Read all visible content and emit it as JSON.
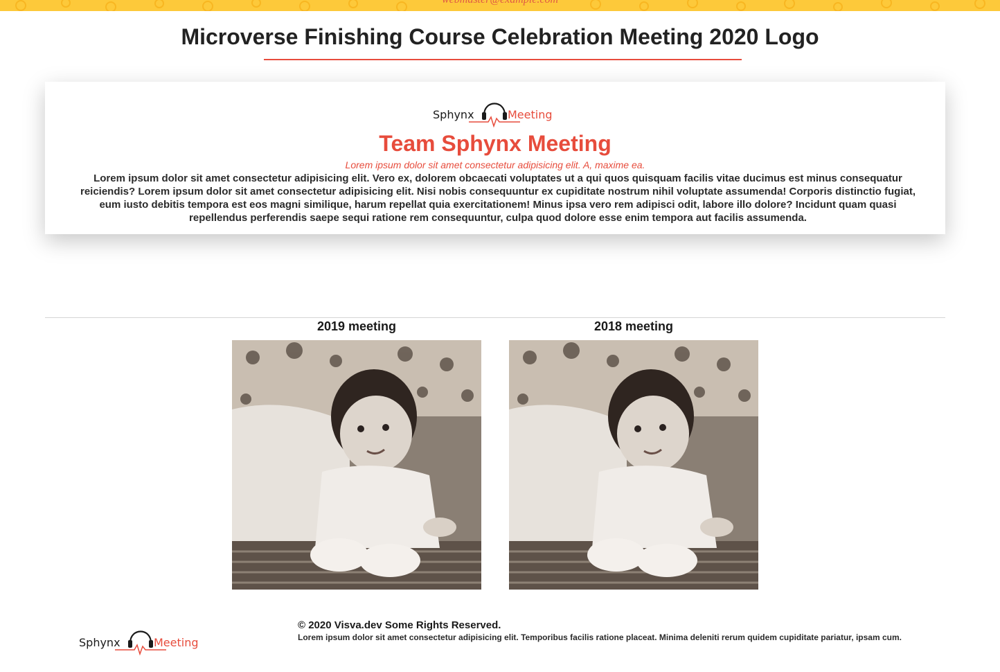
{
  "header": {
    "email": "webmaster@example.com",
    "page_title": "Microverse Finishing Course Celebration Meeting 2020 Logo"
  },
  "about": {
    "logo_left": "Sphynx",
    "logo_right": "Meeting",
    "title": "Team Sphynx Meeting",
    "subtitle": "Lorem ipsum dolor sit amet consectetur adipisicing elit. A, maxime ea.",
    "body": "Lorem ipsum dolor sit amet consectetur adipisicing elit. Vero ex, dolorem obcaecati voluptates ut a qui quos quisquam facilis vitae ducimus est minus consequatur reiciendis? Lorem ipsum dolor sit amet consectetur adipisicing elit. Nisi nobis consequuntur ex cupiditate nostrum nihil voluptate assumenda! Corporis distinctio fugiat, eum iusto debitis tempora est eos magni similique, harum repellat quia exercitationem! Minus ipsa vero rem adipisci odit, labore illo dolore? Incidunt quam quasi repellendus perferendis saepe sequi ratione rem consequuntur, culpa quod dolore esse enim tempora aut facilis assumenda."
  },
  "gallery": {
    "items": [
      {
        "caption": "2019 meeting"
      },
      {
        "caption": "2018 meeting"
      }
    ]
  },
  "footer": {
    "logo_left": "Sphynx",
    "logo_right": "Meeting",
    "copyright": "© 2020 Visva.dev Some Rights Reserved.",
    "text": "Lorem ipsum dolor sit amet consectetur adipisicing elit. Temporibus facilis ratione placeat. Minima deleniti rerum quidem cupiditate pariatur, ipsam cum."
  },
  "colors": {
    "accent": "#e74c3c",
    "top_strip": "#fdc93a",
    "text": "#1a1a1a"
  },
  "icons": [
    "headphones-icon",
    "heartbeat-line-icon"
  ]
}
